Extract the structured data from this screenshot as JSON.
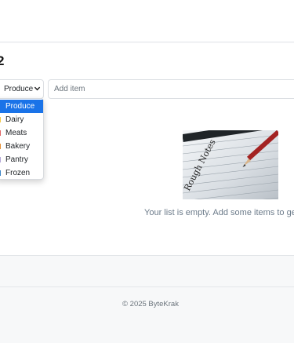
{
  "page": {
    "title": "2"
  },
  "category_select": {
    "selected": "Produce",
    "options": [
      {
        "label": "Produce",
        "color": "#1a73e8"
      },
      {
        "label": "Dairy",
        "color": "#f2c94c"
      },
      {
        "label": "Meats",
        "color": "#e06666"
      },
      {
        "label": "Bakery",
        "color": "#e69138"
      },
      {
        "label": "Pantry",
        "color": "#b4a7d6"
      },
      {
        "label": "Frozen",
        "color": "#3d85c6"
      }
    ]
  },
  "add_item": {
    "placeholder": "Add item"
  },
  "image": {
    "caption": "Rough Notes"
  },
  "empty_state": {
    "message": "Your list is empty. Add some items to get s"
  },
  "footer": {
    "text": "© 2025 ByteKrak"
  }
}
